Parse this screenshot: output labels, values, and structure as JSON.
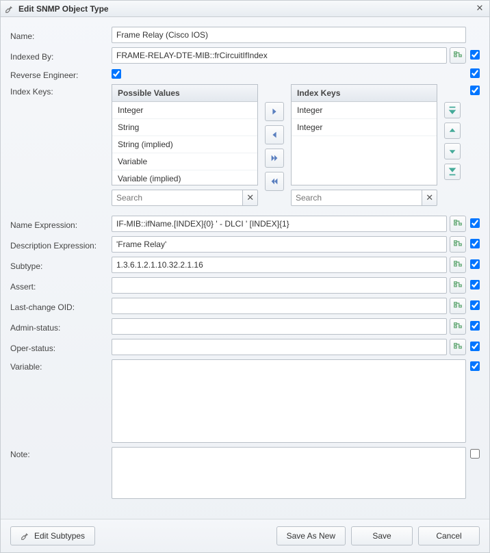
{
  "dialog": {
    "title": "Edit SNMP Object Type"
  },
  "labels": {
    "name": "Name:",
    "indexedBy": "Indexed By:",
    "reverseEngineer": "Reverse Engineer:",
    "indexKeys": "Index Keys:",
    "nameExpr": "Name Expression:",
    "descExpr": "Description Expression:",
    "subtype": "Subtype:",
    "assert": "Assert:",
    "lastChange": "Last-change OID:",
    "adminStatus": "Admin-status:",
    "operStatus": "Oper-status:",
    "variable": "Variable:",
    "note": "Note:"
  },
  "fields": {
    "name": "Frame Relay (Cisco IOS)",
    "indexedBy": "FRAME-RELAY-DTE-MIB::frCircuitIfIndex",
    "nameExpr": "IF-MIB::ifName.[INDEX]{0} ' - DLCI ' [INDEX]{1}",
    "descExpr": "'Frame Relay'",
    "subtype": "1.3.6.1.2.1.10.32.2.1.16",
    "assert": "",
    "lastChange": "",
    "adminStatus": "",
    "operStatus": "",
    "variable": "",
    "note": ""
  },
  "possibleValues": {
    "header": "Possible Values",
    "items": [
      "Integer",
      "String",
      "String (implied)",
      "Variable",
      "Variable (implied)"
    ],
    "searchPlaceholder": "Search"
  },
  "indexKeysList": {
    "header": "Index Keys",
    "items": [
      "Integer",
      "Integer"
    ],
    "searchPlaceholder": "Search"
  },
  "buttons": {
    "editSubtypes": "Edit Subtypes",
    "saveAsNew": "Save As New",
    "save": "Save",
    "cancel": "Cancel"
  }
}
